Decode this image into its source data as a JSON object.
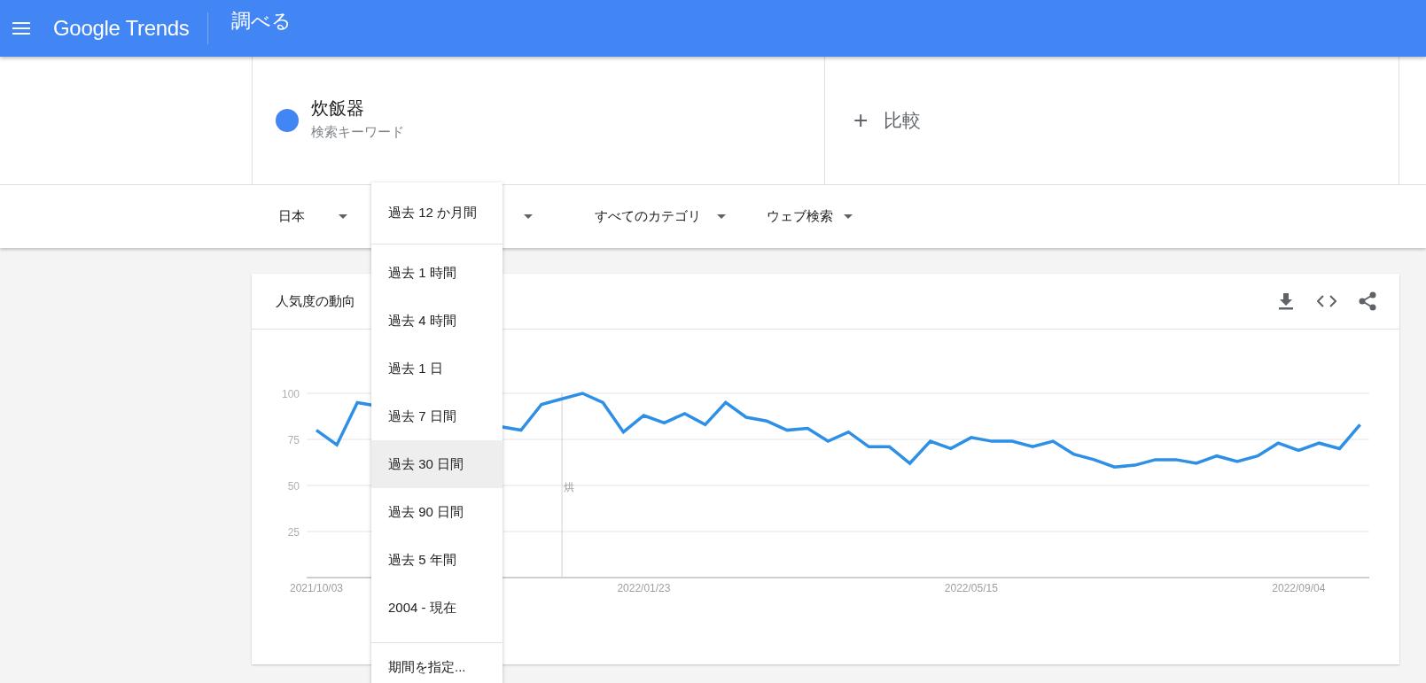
{
  "header": {
    "logo": "Google Trends",
    "title": "調べる"
  },
  "search": {
    "term": {
      "label": "炊飯器",
      "subtitle": "検索キーワード",
      "color": "#4285f4"
    },
    "compare": {
      "icon": "+",
      "label": "比較"
    }
  },
  "filters": [
    {
      "label": "日本",
      "open": false
    },
    {
      "label": "過去 12 か月間",
      "open": true
    },
    {
      "label": "すべてのカテゴリ",
      "open": false
    },
    {
      "label": "ウェブ検索",
      "open": false
    }
  ],
  "period_menu": {
    "items": [
      {
        "label": "過去 1 時間",
        "hovered": false
      },
      {
        "label": "過去 4 時間",
        "hovered": false
      },
      {
        "label": "過去 1 日",
        "hovered": false
      },
      {
        "label": "過去 7 日間",
        "hovered": false
      },
      {
        "label": "過去 30 日間",
        "hovered": true
      },
      {
        "label": "過去 90 日間",
        "hovered": false
      },
      {
        "label": "過去 5 年間",
        "hovered": false
      },
      {
        "label": "2004 - 現在",
        "hovered": false
      }
    ],
    "custom": "期間を指定..."
  },
  "card": {
    "title": "人気度の動向",
    "chart_data": {
      "type": "line",
      "grid": true,
      "ylim": [
        0,
        100
      ],
      "yticks": [
        25,
        50,
        75,
        100
      ],
      "categories": [
        "2021/10/03",
        null,
        null,
        null,
        null,
        null,
        null,
        null,
        null,
        null,
        null,
        null,
        null,
        null,
        null,
        null,
        "2022/01/23",
        null,
        null,
        null,
        null,
        null,
        null,
        null,
        null,
        null,
        null,
        null,
        null,
        null,
        null,
        null,
        "2022/05/15",
        null,
        null,
        null,
        null,
        null,
        null,
        null,
        null,
        null,
        null,
        null,
        null,
        null,
        null,
        null,
        "2022/09/04",
        null,
        null,
        null
      ],
      "series": [
        {
          "color": "#2d8fe6",
          "values": [
            80,
            72,
            95,
            null,
            null,
            null,
            null,
            null,
            null,
            null,
            80,
            94,
            97,
            100,
            95,
            79,
            88,
            84,
            89,
            83,
            95,
            87,
            85,
            80,
            81,
            74,
            79,
            71,
            71,
            62,
            74,
            70,
            76,
            74,
            74,
            71,
            74,
            67,
            64,
            60,
            61,
            64,
            64,
            62,
            66,
            63,
            66,
            73,
            69,
            73,
            70,
            83
          ]
        }
      ],
      "annotations": [
        "烘"
      ]
    }
  }
}
